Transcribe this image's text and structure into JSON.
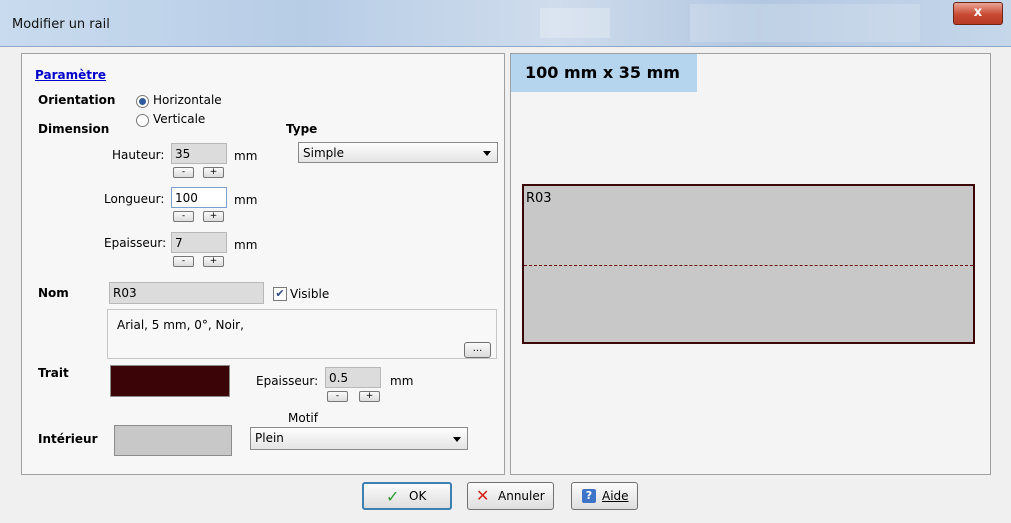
{
  "window": {
    "title": "Modifier un rail",
    "close_symbol": "x"
  },
  "params": {
    "section_link": "Paramètre",
    "orientation_label": "Orientation",
    "orientation_options": [
      "Horizontale",
      "Verticale"
    ],
    "orientation_selected": "Horizontale",
    "dimension_label": "Dimension",
    "type_label": "Type",
    "type_value": "Simple",
    "hauteur": {
      "label": "Hauteur:",
      "value": "35",
      "unit": "mm"
    },
    "longueur": {
      "label": "Longueur:",
      "value": "100",
      "unit": "mm"
    },
    "epaisseur": {
      "label": "Epaisseur:",
      "value": "7",
      "unit": "mm"
    },
    "stepper_minus": "-",
    "stepper_plus": "+",
    "nom_label": "Nom",
    "nom_value": "R03",
    "visible_label": "Visible",
    "visible_checked": true,
    "font_desc": "Arial, 5 mm, 0°, Noir,",
    "font_button": "...",
    "trait_label": "Trait",
    "trait_color": "#3b0406",
    "trait_epaisseur": {
      "label": "Epaisseur:",
      "value": "0.5",
      "unit": "mm"
    },
    "motif_label": "Motif",
    "motif_value": "Plein",
    "interieur_label": "Intérieur",
    "interieur_color": "#c8c8c8"
  },
  "preview": {
    "size_text": "100 mm x 35 mm",
    "rail_name": "R03"
  },
  "buttons": {
    "ok": "OK",
    "cancel": "Annuler",
    "help": "Aide"
  }
}
